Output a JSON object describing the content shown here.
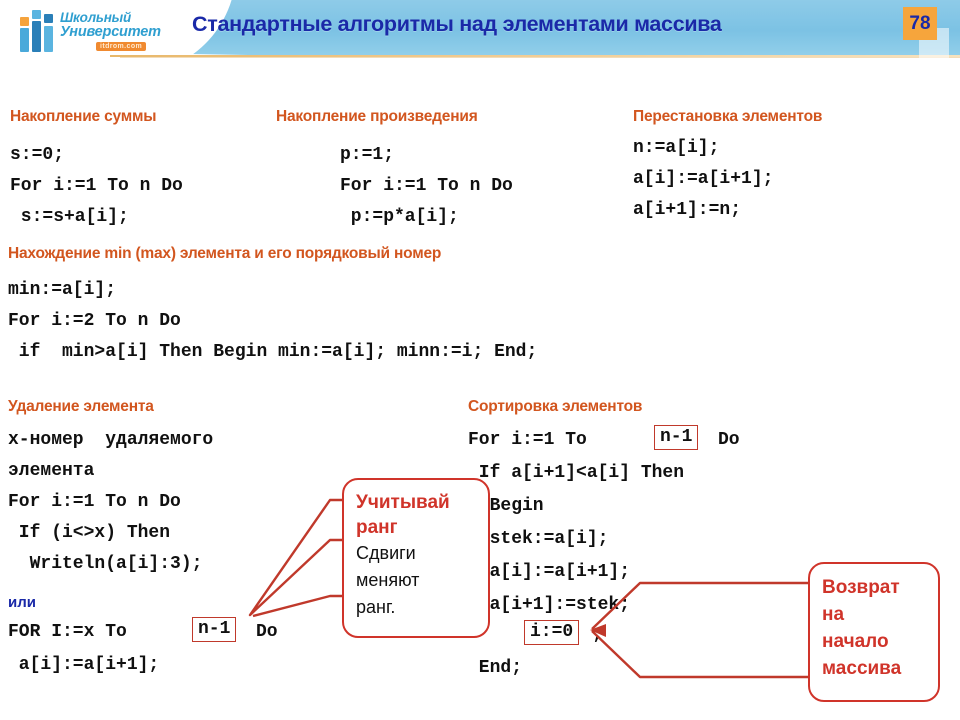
{
  "header": {
    "title": "Стандартные алгоритмы над элементами массива",
    "page_number": "78",
    "band_color": "#7cc2e4",
    "title_color": "#1a29a8",
    "badge_color": "#f6a53c"
  },
  "logo": {
    "line1": "Школьный",
    "line2": "Университет",
    "url": "itdrom.com",
    "color": "#2f9fd0"
  },
  "sections": {
    "sum": {
      "title": "Накопление суммы",
      "code": "s:=0;\nFor i:=1 To n Do\n s:=s+a[i];"
    },
    "product": {
      "title": "Накопление произведения",
      "code": "p:=1;\nFor i:=1 To n Do\n p:=p*a[i];"
    },
    "swap": {
      "title": "Перестановка элементов",
      "code": "n:=a[i];\na[i]:=a[i+1];\na[i+1]:=n;"
    },
    "minmax": {
      "title": "Нахождение  min (max) элемента и его порядковый номер",
      "code": "min:=a[i];\nFor i:=2 To n Do\n if  min>a[i] Then Begin min:=a[i]; minn:=i; End;"
    },
    "delete": {
      "title": "Удаление элемента",
      "code_a": "x-номер  удаляемого\nэлемента\nFor i:=1 To n Do\n If (i<>x) Then\n  Writeln(a[i]:3);",
      "or_label": "или",
      "code_b_pre": "FOR I:=x To ",
      "code_b_box": "n-1",
      "code_b_post": "Do",
      "code_c": " a[i]:=a[i+1];"
    },
    "sort": {
      "title": "Сортировка элементов",
      "line1_pre": "For i:=1 To ",
      "line1_box": "n-1",
      "line1_post": "Do",
      "line2": " If a[i+1]<a[i] Then",
      "line3": "  Begin",
      "line4": "  stek:=a[i];",
      "line5": "  a[i]:=a[i+1];",
      "line6": "  a[i+1]:=stek;",
      "line7_box": "i:=0",
      "line7_post": ";",
      "line8": " End;"
    }
  },
  "callouts": {
    "rank": {
      "heading_line1": "Учитывай",
      "heading_line2": "ранг",
      "body_line1": "Сдвиги",
      "body_line2": "меняют",
      "body_line3": "ранг.",
      "color": "#d0342a"
    },
    "restart": {
      "line1": "Возврат",
      "line2": "на",
      "line3": "начало",
      "line4": "массива",
      "color": "#d0342a"
    }
  }
}
